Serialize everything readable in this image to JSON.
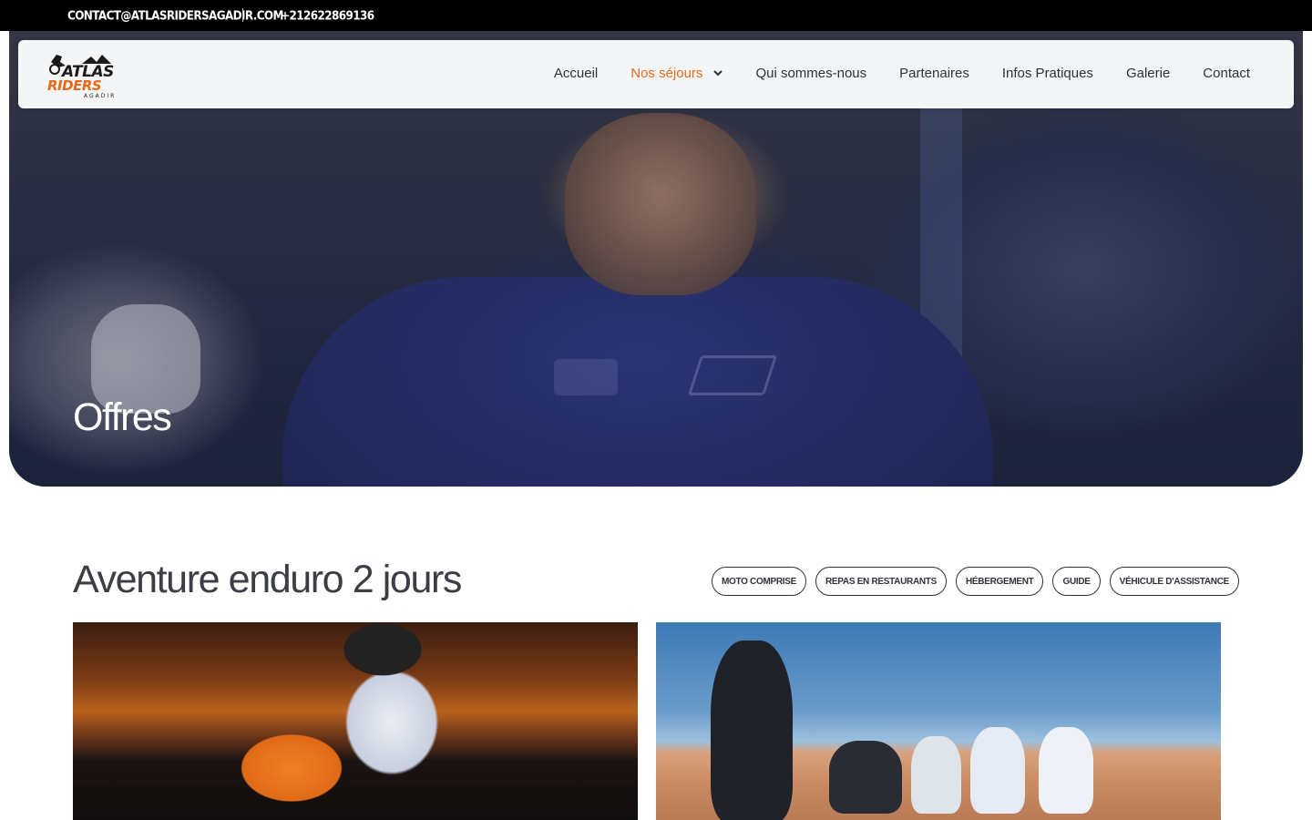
{
  "topbar": {
    "email": "CONTACT@ATLASRIDERSAGADIR.COM",
    "phone": "+212622869136"
  },
  "brand": {
    "logo_text": "ATLAS RIDERS",
    "logo_subtext": "AGADIR",
    "accent_color": "#e56a1b"
  },
  "nav": {
    "items": [
      {
        "label": "Accueil",
        "active": false
      },
      {
        "label": "Nos séjours",
        "active": true,
        "has_dropdown": true
      },
      {
        "label": "Qui sommes-nous",
        "active": false
      },
      {
        "label": "Partenaires",
        "active": false
      },
      {
        "label": "Infos Pratiques",
        "active": false
      },
      {
        "label": "Galerie",
        "active": false
      },
      {
        "label": "Contact",
        "active": false
      }
    ],
    "dropdown_icon": "chevron-down-icon"
  },
  "hero": {
    "title": "Offres"
  },
  "offer": {
    "title": "Aventure enduro 2 jours",
    "tags": [
      "MOTO COMPRISE",
      "REPAS EN RESTAURANTS",
      "HÉBERGEMENT",
      "GUIDE",
      "VÉHICULE D'ASSISTANCE"
    ]
  }
}
